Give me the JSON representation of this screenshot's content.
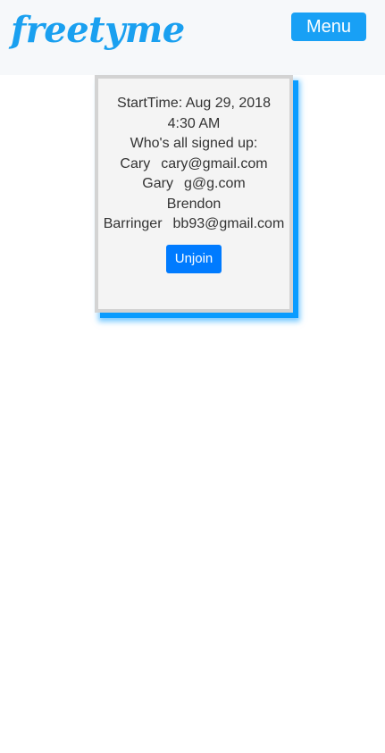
{
  "header": {
    "logo_text": "freetyme",
    "menu_label": "Menu"
  },
  "event_card": {
    "start_time_label": "StartTime: Aug 29, 2018",
    "start_time_clock": "4:30 AM",
    "signed_up_heading": "Who's all signed up:",
    "participants": [
      {
        "first": "Cary",
        "email": "cary@gmail.com"
      },
      {
        "first": "Gary",
        "email": "g@g.com"
      },
      {
        "first": "Brendon",
        "last": "Barringer",
        "email": "bb93@gmail.com"
      }
    ],
    "unjoin_label": "Unjoin"
  },
  "colors": {
    "brand": "#1aa0f0",
    "menu_button": "#18a0f5",
    "unjoin_button": "#007bff",
    "card_shadow": "#0a9cff"
  }
}
